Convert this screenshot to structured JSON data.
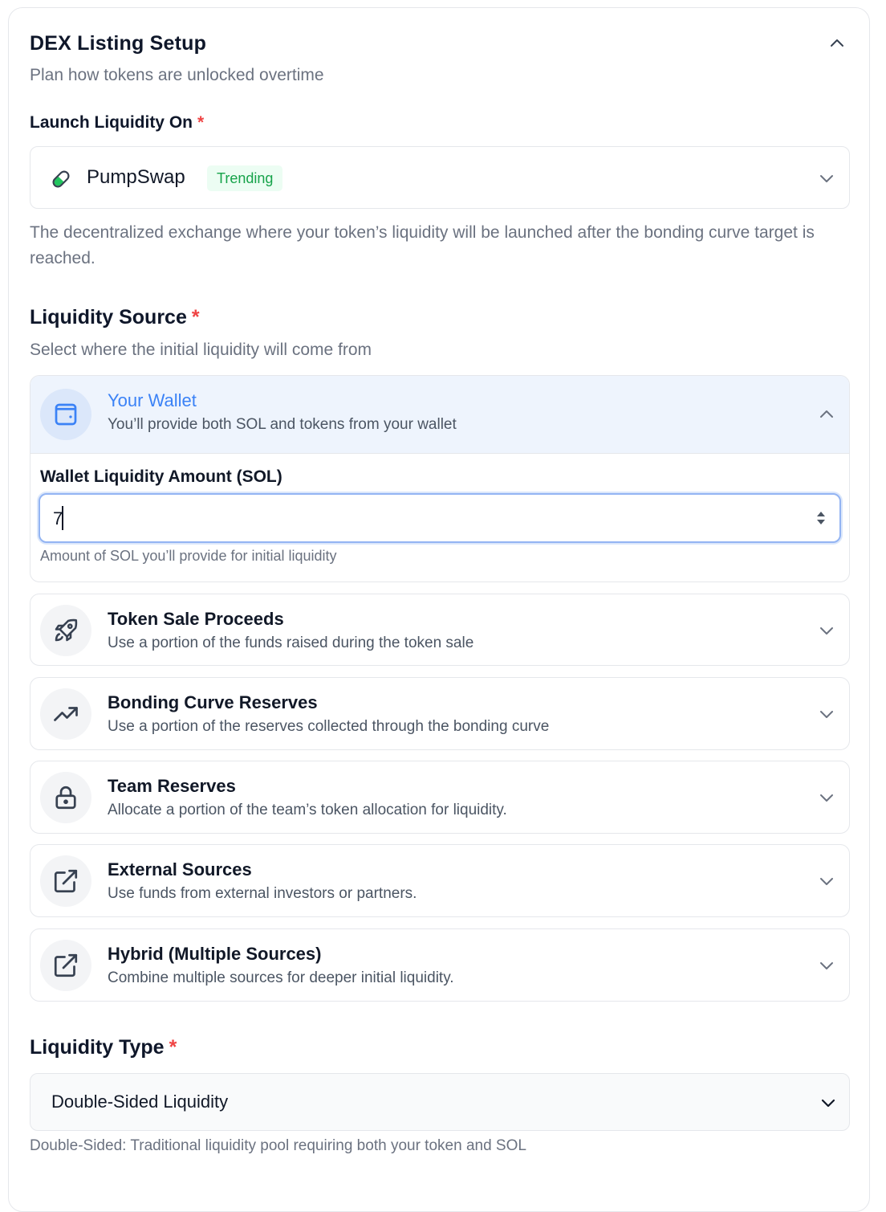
{
  "header": {
    "title": "DEX Listing Setup",
    "subtitle": "Plan how tokens are unlocked overtime"
  },
  "launch": {
    "label": "Launch Liquidity On",
    "required_mark": "*",
    "selected_name": "PumpSwap",
    "selected_badge": "Trending",
    "help": "The decentralized exchange where your token’s liquidity will be launched after the bonding curve target is reached."
  },
  "source": {
    "title": "Liquidity Source",
    "required_mark": "*",
    "subtitle": "Select where the initial liquidity will come from",
    "wallet": {
      "title": "Your Wallet",
      "desc": "You’ll provide both SOL and tokens from your wallet",
      "amount_label": "Wallet Liquidity Amount (SOL)",
      "amount_value": "7",
      "amount_help": "Amount of SOL you’ll provide for initial liquidity"
    },
    "options": [
      {
        "title": "Token Sale Proceeds",
        "desc": "Use a portion of the funds raised during the token sale",
        "icon": "rocket-icon"
      },
      {
        "title": "Bonding Curve Reserves",
        "desc": "Use a portion of the reserves collected through the bonding curve",
        "icon": "trending-up-icon"
      },
      {
        "title": "Team Reserves",
        "desc": "Allocate a portion of the team’s token allocation for liquidity.",
        "icon": "lock-icon"
      },
      {
        "title": "External Sources",
        "desc": "Use funds from external investors or partners.",
        "icon": "external-link-icon"
      },
      {
        "title": "Hybrid (Multiple Sources)",
        "desc": "Combine multiple sources for deeper initial liquidity.",
        "icon": "external-link-icon"
      }
    ]
  },
  "type": {
    "title": "Liquidity Type",
    "required_mark": "*",
    "selected": "Double-Sided Liquidity",
    "help": "Double-Sided: Traditional liquidity pool requiring both your token and SOL"
  },
  "colors": {
    "accent": "#3b82f6",
    "required": "#ef4444",
    "badge_text": "#16a34a",
    "badge_bg": "#ecfdf3",
    "active_bg": "#eef4fd"
  }
}
